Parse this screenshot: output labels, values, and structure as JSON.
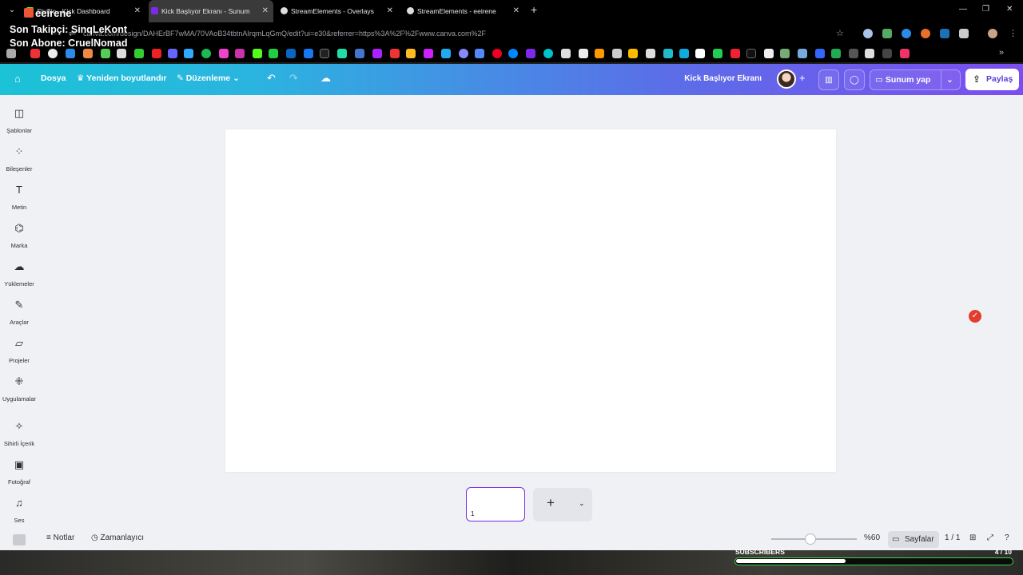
{
  "browser": {
    "tabs": [
      {
        "label": "Studio - Kick Dashboard",
        "color": "#53fc18"
      },
      {
        "label": "Kick Başlıyor Ekranı - Sunum",
        "color": "#7d2ae8"
      },
      {
        "label": "StreamElements - Overlays",
        "color": "#ffffff"
      },
      {
        "label": "StreamElements - eeirene",
        "color": "#ffffff"
      }
    ],
    "url": "canva.com/design/DAHErBF7wMA/70VAoB34tbtnAIrqmLqGmQ/edit?ui=e30&referrer=https%3A%2F%2Fwww.canva.com%2F"
  },
  "overlay": {
    "brand": "eeirene",
    "last_follower": "Son Takipçi: SinqLeKont",
    "last_subscriber": "Son Abone: CruelNomad"
  },
  "canva": {
    "menu_file": "Dosya",
    "menu_resize": "Yeniden boyutlandır",
    "menu_edit": "Düzenleme",
    "design_title": "Kick Başlıyor Ekranı",
    "present_label": "Sunum yap",
    "share_label": "Paylaş",
    "sidebar": [
      {
        "label": "Şablonlar",
        "icon": "template-icon"
      },
      {
        "label": "Bileşenler",
        "icon": "elements-icon"
      },
      {
        "label": "Metin",
        "icon": "text-icon"
      },
      {
        "label": "Marka",
        "icon": "brand-icon"
      },
      {
        "label": "Yüklemeler",
        "icon": "upload-icon"
      },
      {
        "label": "Araçlar",
        "icon": "draw-icon"
      },
      {
        "label": "Projeler",
        "icon": "folder-icon"
      },
      {
        "label": "Uygulamalar",
        "icon": "apps-icon"
      },
      {
        "label": "Sihirli İçerik",
        "icon": "magic-icon"
      },
      {
        "label": "Fotoğraf",
        "icon": "photo-icon"
      },
      {
        "label": "Ses",
        "icon": "music-icon"
      }
    ],
    "page_thumb_number": "1",
    "notes_label": "Notlar",
    "timer_label": "Zamanlayıcı",
    "zoom_label": "%60",
    "zoom_fraction": 0.46,
    "pages_label": "Sayfalar",
    "page_count": "1 / 1"
  },
  "stream": {
    "subs_label": "SUBSCRIBERS",
    "subs_count": "4 / 10",
    "subs_progress": 0.4
  }
}
